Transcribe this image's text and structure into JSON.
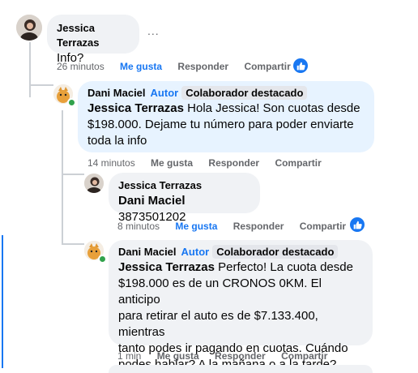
{
  "comments": [
    {
      "author": "Jessica Terrazas",
      "text": "Info?",
      "more": "...",
      "time": "26 minutos",
      "like": "Me gusta",
      "reply": "Responder",
      "share": "Compartir"
    },
    {
      "author": "Dani Maciel",
      "role": "Autor",
      "badge": "Colaborador destacado",
      "mention": "Jessica Terrazas",
      "text_lines": [
        "Hola Jessica! Son cuotas desde",
        "$198.000. Dejame tu número para poder enviarte",
        "toda la info"
      ],
      "time": "14 minutos",
      "like": "Me gusta",
      "reply": "Responder",
      "share": "Compartir"
    },
    {
      "author": "Jessica Terrazas",
      "mention": "Dani Maciel",
      "text": "3873501202",
      "time": "8 minutos",
      "like": "Me gusta",
      "reply": "Responder",
      "share": "Compartir"
    },
    {
      "author": "Dani Maciel",
      "role": "Autor",
      "badge": "Colaborador destacado",
      "mention": "Jessica Terrazas",
      "text_lines": [
        "Perfecto! La cuota desde",
        "$198.000 es de un CRONOS 0KM. El anticipo",
        "para retirar el auto es de $7.133.400, mientras",
        "tanto podes ir pagando en cuotas. Cuándo",
        "podes hablar? A la mañana o a la tarde?"
      ],
      "time": "1 min",
      "like": "Me gusta",
      "reply": "Responder",
      "share": "Compartir"
    }
  ],
  "icons": [
    "like-reaction-icon",
    "more-options-icon"
  ],
  "colors": {
    "accent": "#1877f2",
    "bubble": "#f0f2f5",
    "highlight": "#e7f3ff",
    "meta": "#65676b"
  }
}
